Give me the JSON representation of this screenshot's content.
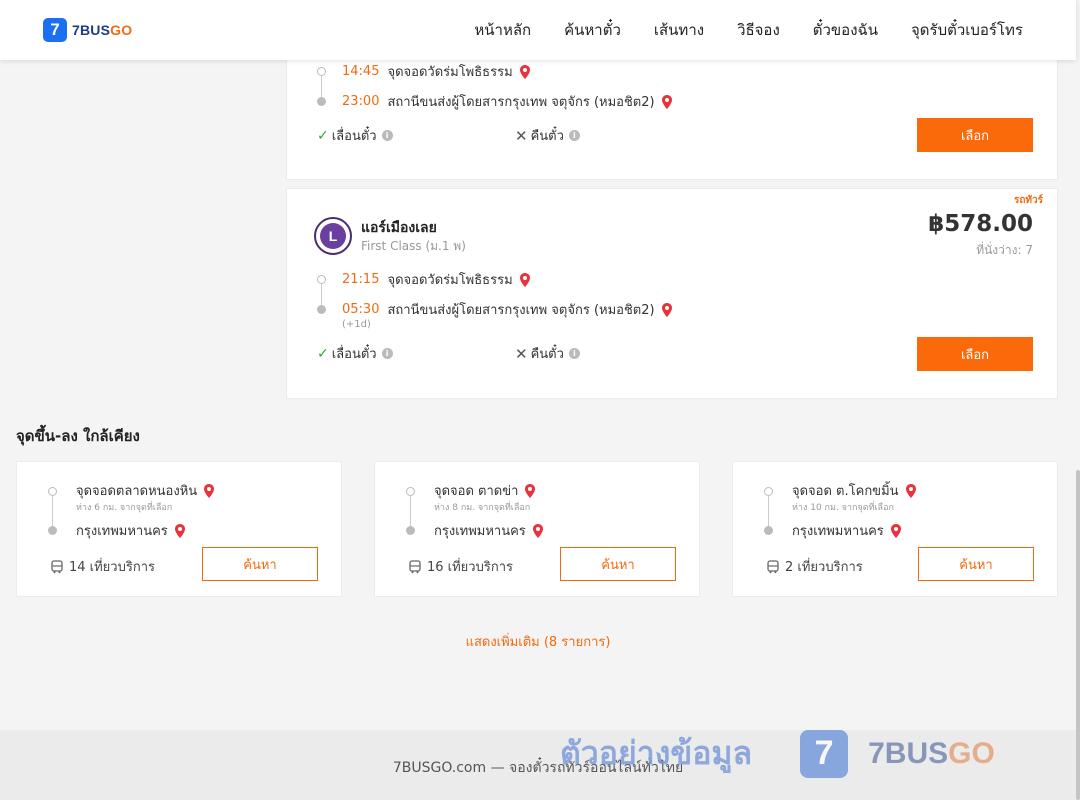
{
  "header": {
    "logo_num": "7",
    "logo_a": "7BUS",
    "logo_b": "GO",
    "nav": [
      "หน้าหลัก",
      "ค้นหาตั๋ว",
      "เส้นทาง",
      "วิธีจอง",
      "ตั๋วของฉัน",
      "จุดรับตั๋วเบอร์โทร"
    ]
  },
  "trips": [
    {
      "dep_time": "14:45",
      "dep_place": "จุดจอดวัดร่มโพธิธรรม",
      "arr_time": "23:00",
      "arr_place": "สถานีขนส่งผู้โดยสารกรุงเทพ จตุจักร (หมอชิต2)",
      "change": "เลื่อนตั๋ว",
      "refund": "คืนตั๋ว",
      "select_label": "เลือก"
    },
    {
      "badge": "รถทัวร์",
      "operator_initial": "L",
      "operator": "แอร์เมืองเลย",
      "class": "First Class (ม.1 พ)",
      "price": "฿578.00",
      "seats": "ที่นั่งว่าง: 7",
      "dep_time": "21:15",
      "dep_place": "จุดจอดวัดร่มโพธิธรรม",
      "arr_time": "05:30",
      "arr_place": "สถานีขนส่งผู้โดยสารกรุงเทพ จตุจักร (หมอชิต2)",
      "next_day": "(+1d)",
      "change": "เลื่อนตั๋ว",
      "refund": "คืนตั๋ว",
      "select_label": "เลือก"
    }
  ],
  "nearby": {
    "title": "จุดขึ้น-ลง ใกล้เคียง",
    "items": [
      {
        "from": "จุดจอดตลาดหนองหิน",
        "distance": "ห่าง 6 กม. จากจุดที่เลือก",
        "to": "กรุงเทพมหานคร",
        "trips": "14 เที่ยวบริการ",
        "search_label": "ค้นหา"
      },
      {
        "from": "จุดจอด ตาดข่า",
        "distance": "ห่าง 8 กม. จากจุดที่เลือก",
        "to": "กรุงเทพมหานคร",
        "trips": "16 เที่ยวบริการ",
        "search_label": "ค้นหา"
      },
      {
        "from": "จุดจอด ต.โคกขมิ้น",
        "distance": "ห่าง 10 กม. จากจุดที่เลือก",
        "to": "กรุงเทพมหานคร",
        "trips": "2 เที่ยวบริการ",
        "search_label": "ค้นหา"
      }
    ],
    "show_more": "แสดงเพิ่มเติม (8 รายการ)"
  },
  "footer": {
    "text": "7BUSGO.com — จองตั๋วรถทัวร์ออนไลน์ทั่วไทย"
  },
  "watermark": {
    "text": "ตัวอย่างข้อมูล",
    "logo_num": "7",
    "brand_a": "7BUS",
    "brand_b": "GO"
  }
}
